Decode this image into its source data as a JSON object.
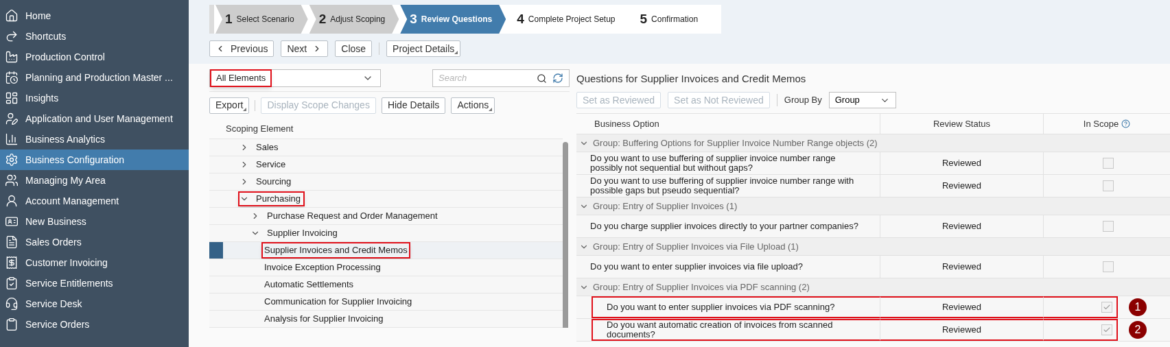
{
  "sidebar": {
    "items": [
      {
        "label": "Home",
        "selected": false
      },
      {
        "label": "Shortcuts",
        "selected": false
      },
      {
        "label": "Production Control",
        "selected": false
      },
      {
        "label": "Planning and Production Master ...",
        "selected": false
      },
      {
        "label": "Insights",
        "selected": false
      },
      {
        "label": "Application and User Management",
        "selected": false
      },
      {
        "label": "Business Analytics",
        "selected": false
      },
      {
        "label": "Business Configuration",
        "selected": true
      },
      {
        "label": "Managing My Area",
        "selected": false
      },
      {
        "label": "Account Management",
        "selected": false
      },
      {
        "label": "New Business",
        "selected": false
      },
      {
        "label": "Sales Orders",
        "selected": false
      },
      {
        "label": "Customer Invoicing",
        "selected": false
      },
      {
        "label": "Service Entitlements",
        "selected": false
      },
      {
        "label": "Service Desk",
        "selected": false
      },
      {
        "label": "Service Orders",
        "selected": false
      }
    ]
  },
  "wizard": {
    "steps": [
      {
        "number": "1",
        "label": "Select Scenario",
        "completed": true,
        "selected": false
      },
      {
        "number": "2",
        "label": "Adjust Scoping",
        "completed": true,
        "selected": false
      },
      {
        "number": "3",
        "label": "Review Questions",
        "completed": false,
        "selected": true
      },
      {
        "number": "4",
        "label": "Complete Project Setup",
        "completed": false,
        "selected": false
      },
      {
        "number": "5",
        "label": "Confirmation",
        "completed": false,
        "selected": false
      }
    ]
  },
  "toolbar": {
    "buttons": [
      {
        "label": "Previous",
        "kind": "back"
      },
      {
        "label": "Next",
        "kind": "forward"
      },
      {
        "label": "Close",
        "kind": "plain"
      },
      {
        "label": "Project Details",
        "kind": "menu"
      }
    ]
  },
  "scoping": {
    "filter": {
      "value": "All Elements",
      "highlighted": true
    },
    "search": {
      "placeholder": "Search"
    },
    "buttons": [
      {
        "label": "Export",
        "kind": "menu",
        "disabled": false
      },
      {
        "label": "Display Scope Changes",
        "kind": "plain",
        "disabled": true
      },
      {
        "label": "Hide Details",
        "kind": "plain",
        "disabled": false
      },
      {
        "label": "Actions",
        "kind": "menu",
        "disabled": false
      }
    ],
    "column": "Scoping Element",
    "tree": [
      {
        "label": "Sales",
        "expanded": false,
        "selected": false,
        "highlighted": false
      },
      {
        "label": "Service",
        "expanded": false,
        "selected": false,
        "highlighted": false
      },
      {
        "label": "Sourcing",
        "expanded": false,
        "selected": false,
        "highlighted": false
      },
      {
        "label": "Purchasing",
        "expanded": true,
        "selected": false,
        "highlighted": true,
        "children": [
          {
            "label": "Purchase Request and Order Management",
            "expanded": false,
            "selected": false,
            "highlighted": false
          },
          {
            "label": "Supplier Invoicing",
            "expanded": true,
            "selected": false,
            "highlighted": false,
            "children": [
              {
                "label": "Supplier Invoices and Credit Memos",
                "selected": true,
                "highlighted": true
              },
              {
                "label": "Invoice Exception Processing",
                "selected": false,
                "highlighted": false
              },
              {
                "label": "Automatic Settlements",
                "selected": false,
                "highlighted": false
              },
              {
                "label": "Communication for Supplier Invoicing",
                "selected": false,
                "highlighted": false
              },
              {
                "label": "Analysis for Supplier Invoicing",
                "selected": false,
                "highlighted": false
              }
            ]
          }
        ]
      }
    ]
  },
  "questions": {
    "title": "Questions for Supplier Invoices and Credit Memos",
    "buttons": [
      {
        "label": "Set as Reviewed",
        "disabled": true
      },
      {
        "label": "Set as Not Reviewed",
        "disabled": true
      }
    ],
    "group_by": {
      "label": "Group By",
      "value": "Group"
    },
    "columns": [
      "Business Option",
      "Review Status",
      "In Scope"
    ],
    "groups": [
      {
        "title": "Group: Buffering Options for Supplier Invoice Number Range objects (2)",
        "expanded": true,
        "rows": [
          {
            "question": "Do you want to use buffering of supplier invoice number range possibly not sequential but without gaps?",
            "status": "Reviewed",
            "in_scope": false,
            "highlighted": false
          },
          {
            "question": "Do you want to use buffering of supplier invoice number range with possible gaps but pseudo sequential?",
            "status": "Reviewed",
            "in_scope": false,
            "highlighted": false
          }
        ]
      },
      {
        "title": "Group: Entry of Supplier Invoices (1)",
        "expanded": true,
        "rows": [
          {
            "question": "Do you charge supplier invoices directly to your partner companies?",
            "status": "Reviewed",
            "in_scope": false,
            "highlighted": false
          }
        ]
      },
      {
        "title": "Group: Entry of Supplier Invoices via File Upload (1)",
        "expanded": true,
        "rows": [
          {
            "question": "Do you want to enter supplier invoices via file upload?",
            "status": "Reviewed",
            "in_scope": false,
            "highlighted": false
          }
        ]
      },
      {
        "title": "Group: Entry of Supplier Invoices via PDF scanning (2)",
        "expanded": true,
        "rows": [
          {
            "question": "Do you want to enter supplier invoices via PDF scanning?",
            "status": "Reviewed",
            "in_scope": true,
            "highlighted": true,
            "callout": "1"
          },
          {
            "question": "Do you want automatic creation of invoices from scanned documents?",
            "status": "Reviewed",
            "in_scope": true,
            "highlighted": true,
            "callout": "2"
          }
        ]
      }
    ]
  }
}
